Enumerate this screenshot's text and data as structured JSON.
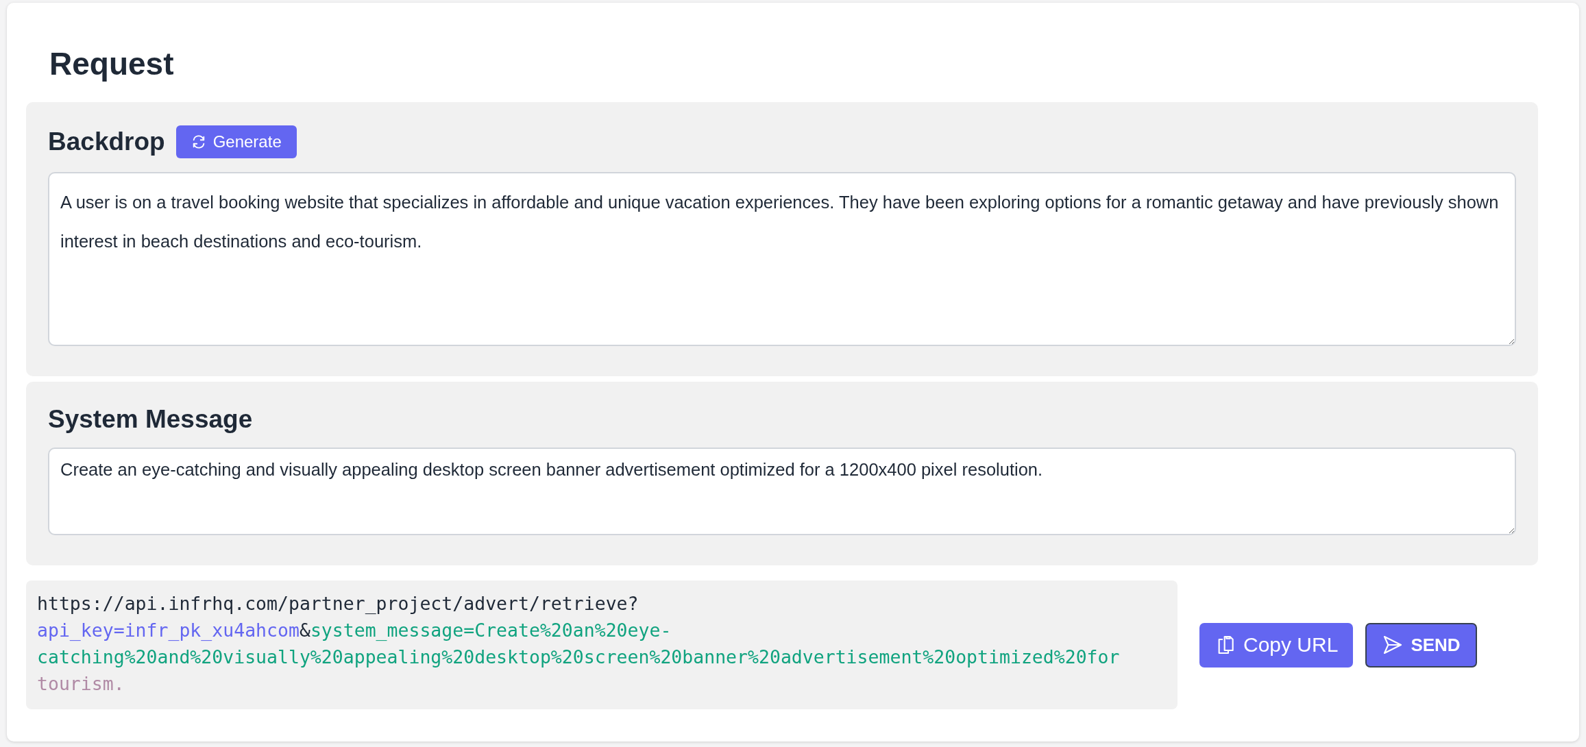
{
  "title": "Request",
  "sections": [
    {
      "heading": "Backdrop",
      "button": {
        "label": "Generate"
      },
      "value": "A user is on a travel booking website that specializes in affordable and unique vacation experiences. They have been exploring options for a romantic getaway and have previously shown interest in beach destinations and eco-tourism."
    },
    {
      "heading": "System Message",
      "value": "Create an eye-catching and visually appealing desktop screen banner advertisement optimized for a 1200x400 pixel resolution."
    }
  ],
  "url_lines": [
    [
      {
        "kind": "base",
        "text": "https://api.infrhq.com/partner_project/advert/retrieve?"
      }
    ],
    [
      {
        "kind": "key",
        "text": "api_key=infr_pk_xu4ahcom"
      },
      {
        "kind": "base",
        "text": "&"
      },
      {
        "kind": "param",
        "text": "system_message=Create%20an%20eye-"
      }
    ],
    [
      {
        "kind": "param",
        "text": "catching%20and%20visually%20appealing%20desktop%20screen%20banner%20advertisement%20optimized%20for"
      }
    ],
    [
      {
        "kind": "tail",
        "text": "tourism."
      }
    ]
  ],
  "actions": [
    {
      "kind": "copy",
      "label": "Copy URL"
    },
    {
      "kind": "send",
      "label": "SEND"
    }
  ]
}
